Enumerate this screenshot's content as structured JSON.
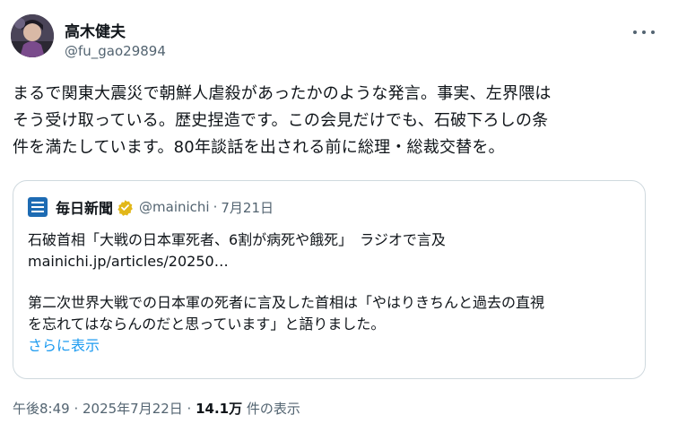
{
  "author": {
    "display_name": "高木健夫",
    "handle": "@fu_gao29894"
  },
  "icons": {
    "more": "more-horizontal-icon",
    "verified": "gold-verified-badge-icon",
    "quote_logo": "mainichi-logo-icon"
  },
  "colors": {
    "text_primary": "#0f1419",
    "text_secondary": "#536471",
    "link": "#1d9bf0",
    "border": "#cfd9de",
    "verified_gold": "#e2b719",
    "mainichi_blue": "#1d6bb3"
  },
  "tweet": {
    "lines": [
      "まるで関東大震災で朝鮮人虐殺があったかのような発言。事実、左界隈は",
      "そう受け取っている。歴史捏造です。この会見だけでも、石破下ろしの条",
      "件を満たしています。80年談話を出される前に総理・総裁交替を。"
    ]
  },
  "quote": {
    "name": "毎日新聞",
    "handle": "@mainichi",
    "separator": "·",
    "date": "7月21日",
    "lines": [
      "石破首相「大戦の日本軍死者、6割が病死や餓死」　ラジオで言及",
      "mainichi.jp/articles/20250…",
      "",
      "第二次世界大戦での日本軍の死者に言及した首相は「やはりきちんと過去の直視",
      "を忘れてはならんのだと思っています」と語りました。"
    ],
    "show_more": "さらに表示"
  },
  "meta": {
    "timestamp": "午後8:49 · 2025年7月22日 · ",
    "views_count": "14.1万",
    "views_label": " 件の表示"
  }
}
